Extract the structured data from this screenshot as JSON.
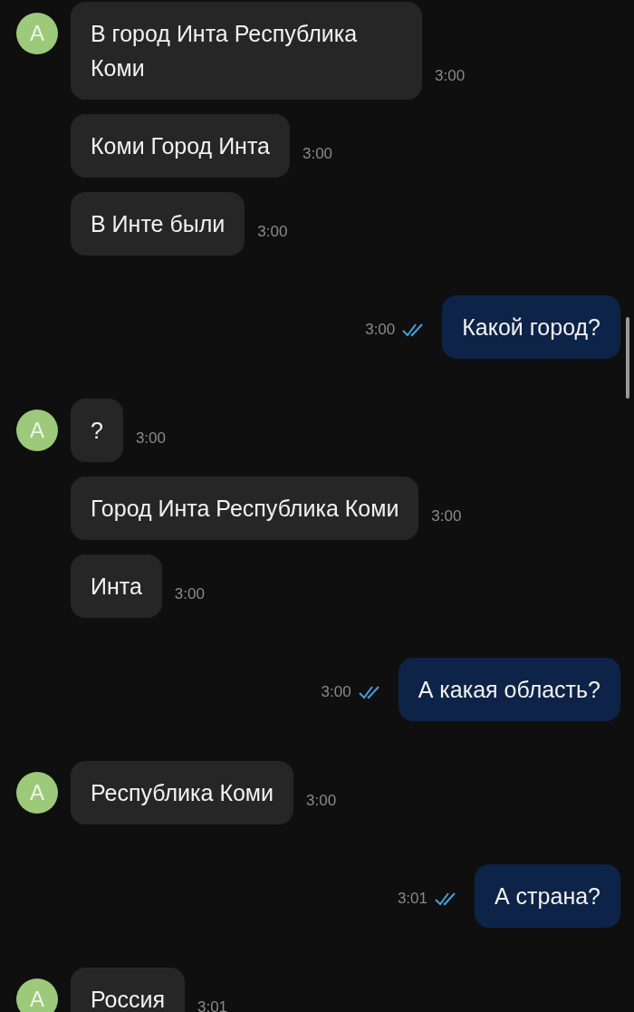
{
  "messages": [
    {
      "kind": "incoming",
      "avatar": "A",
      "bubbles": [
        {
          "text": "В город Инта Республика Коми",
          "time": "3:00"
        },
        {
          "text": "Коми Город Инта",
          "time": "3:00"
        },
        {
          "text": "В Инте были",
          "time": "3:00"
        }
      ]
    },
    {
      "kind": "outgoing",
      "text": "Какой город?",
      "time": "3:00",
      "read": true
    },
    {
      "kind": "incoming",
      "avatar": "A",
      "bubbles": [
        {
          "text": "?",
          "time": "3:00"
        },
        {
          "text": "Город Инта Республика Коми",
          "time": "3:00"
        },
        {
          "text": "Инта",
          "time": "3:00"
        }
      ]
    },
    {
      "kind": "outgoing",
      "text": "А какая область?",
      "time": "3:00",
      "read": true
    },
    {
      "kind": "incoming",
      "avatar": "A",
      "bubbles": [
        {
          "text": "Республика Коми",
          "time": "3:00"
        }
      ]
    },
    {
      "kind": "outgoing",
      "text": "А страна?",
      "time": "3:01",
      "read": true
    },
    {
      "kind": "incoming",
      "avatar": "A",
      "bubbles": [
        {
          "text": "Россия",
          "time": "3:01"
        }
      ]
    }
  ]
}
